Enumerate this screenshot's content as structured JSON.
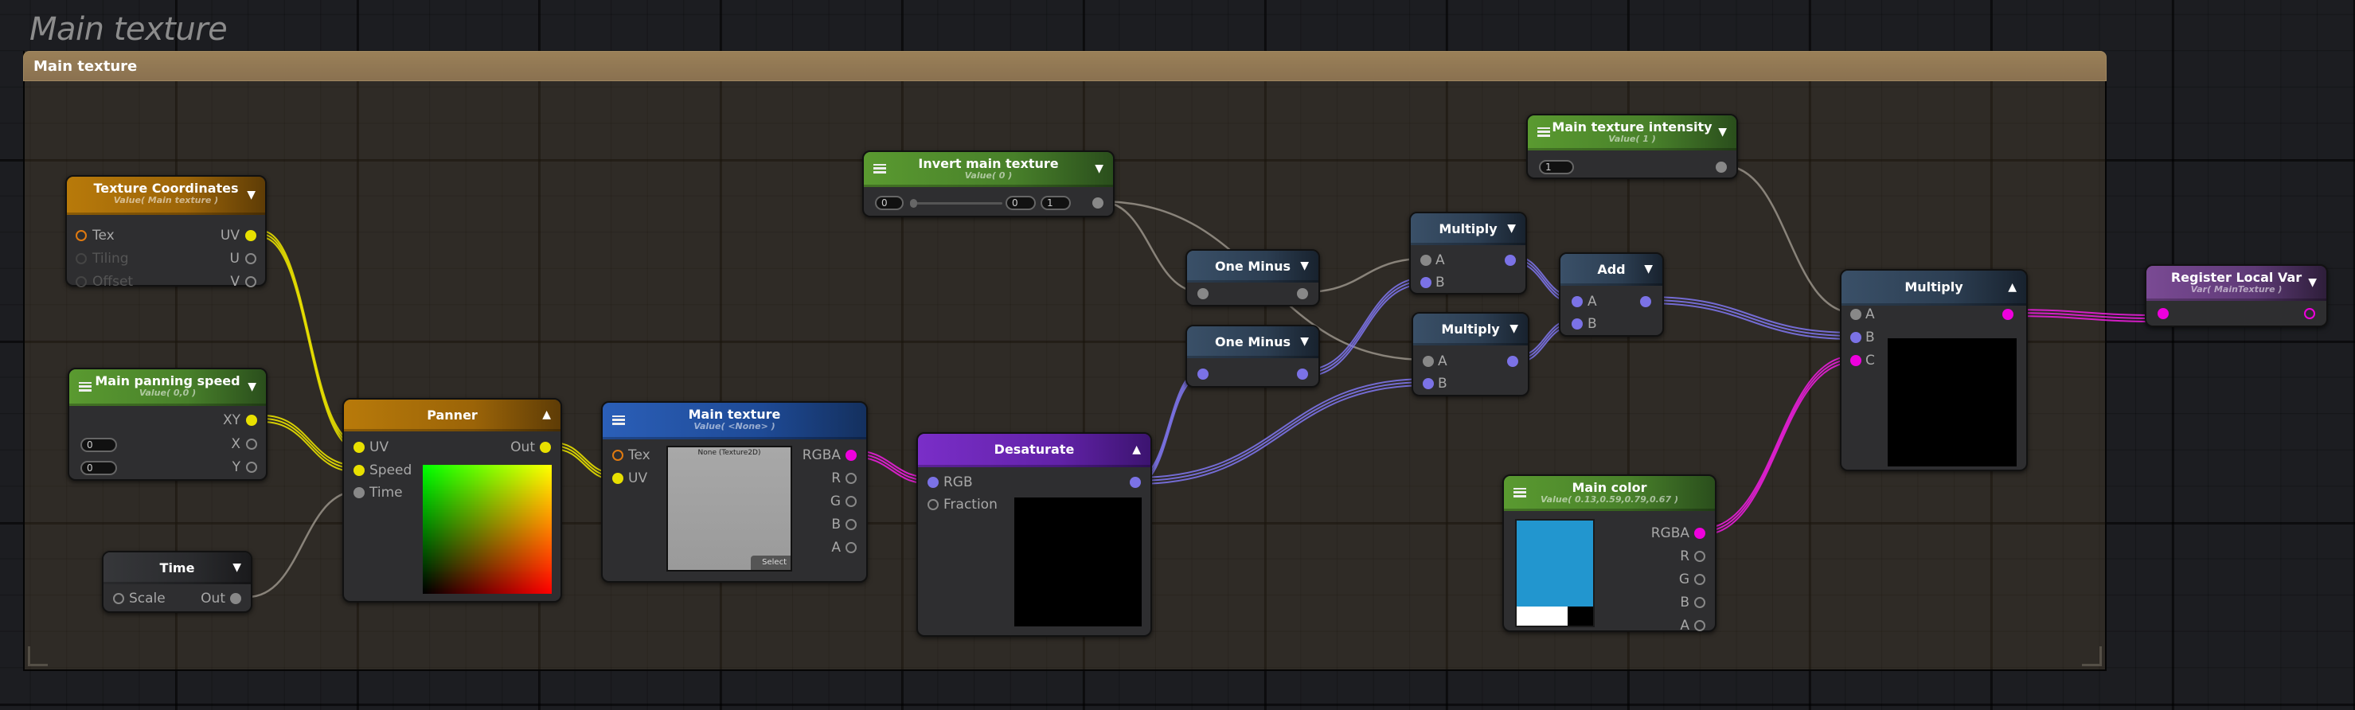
{
  "canvas_title": "Main texture",
  "group": {
    "title": "Main texture"
  },
  "colors": {
    "uv_wire": "#e8e000",
    "float_wire": "#a09a90",
    "rgb_wire": "#7b72e6",
    "rgba_wire": "#e81ed8",
    "main_color_swatch": "#2296cf"
  },
  "nodes": {
    "texture_coordinates": {
      "title": "Texture Coordinates",
      "subtitle": "Value( Main texture )",
      "toggle_icon": "▼",
      "inputs": [
        "Tex",
        "Tiling",
        "Offset"
      ],
      "outputs": [
        "UV",
        "U",
        "V"
      ]
    },
    "main_panning_speed": {
      "title": "Main panning speed",
      "subtitle": "Value( 0,0 )",
      "toggle_icon": "▼",
      "fields": [
        "0",
        "0"
      ],
      "outputs": [
        "XY",
        "X",
        "Y"
      ]
    },
    "time": {
      "title": "Time",
      "toggle_icon": "▼",
      "inputs": [
        "Scale"
      ],
      "outputs": [
        "Out"
      ]
    },
    "panner": {
      "title": "Panner",
      "toggle_icon": "▲",
      "inputs": [
        "UV",
        "Speed",
        "Time"
      ],
      "outputs": [
        "Out"
      ]
    },
    "main_texture": {
      "title": "Main texture",
      "subtitle": "Value( <None> )",
      "inputs": [
        "Tex",
        "UV"
      ],
      "outputs": [
        "RGBA",
        "R",
        "G",
        "B",
        "A"
      ],
      "texture_label": "None (Texture2D)",
      "select_label": "Select"
    },
    "desaturate": {
      "title": "Desaturate",
      "toggle_icon": "▲",
      "inputs": [
        "RGB",
        "Fraction"
      ]
    },
    "invert_main_texture": {
      "title": "Invert main texture",
      "subtitle": "Value( 0 )",
      "toggle_icon": "▼",
      "value": "0",
      "slider_value": 0,
      "min": "0",
      "max": "1"
    },
    "one_minus_1": {
      "title": "One Minus",
      "toggle_icon": "▼"
    },
    "one_minus_2": {
      "title": "One Minus",
      "toggle_icon": "▼"
    },
    "multiply_1": {
      "title": "Multiply",
      "toggle_icon": "▼",
      "inputs": [
        "A",
        "B"
      ]
    },
    "multiply_2": {
      "title": "Multiply",
      "toggle_icon": "▼",
      "inputs": [
        "A",
        "B"
      ]
    },
    "add": {
      "title": "Add",
      "toggle_icon": "▼",
      "inputs": [
        "A",
        "B"
      ]
    },
    "main_texture_intensity": {
      "title": "Main texture intensity",
      "subtitle": "Value( 1 )",
      "toggle_icon": "▼",
      "value": "1"
    },
    "multiply_3": {
      "title": "Multiply",
      "toggle_icon": "▲",
      "inputs": [
        "A",
        "B",
        "C"
      ]
    },
    "main_color": {
      "title": "Main color",
      "subtitle": "Value( 0.13,0.59,0.79,0.67 )",
      "outputs": [
        "RGBA",
        "R",
        "G",
        "B",
        "A"
      ],
      "alpha": 0.67
    },
    "register_local_var": {
      "title": "Register Local Var",
      "subtitle": "Var( MainTexture )",
      "toggle_icon": "▼"
    }
  }
}
